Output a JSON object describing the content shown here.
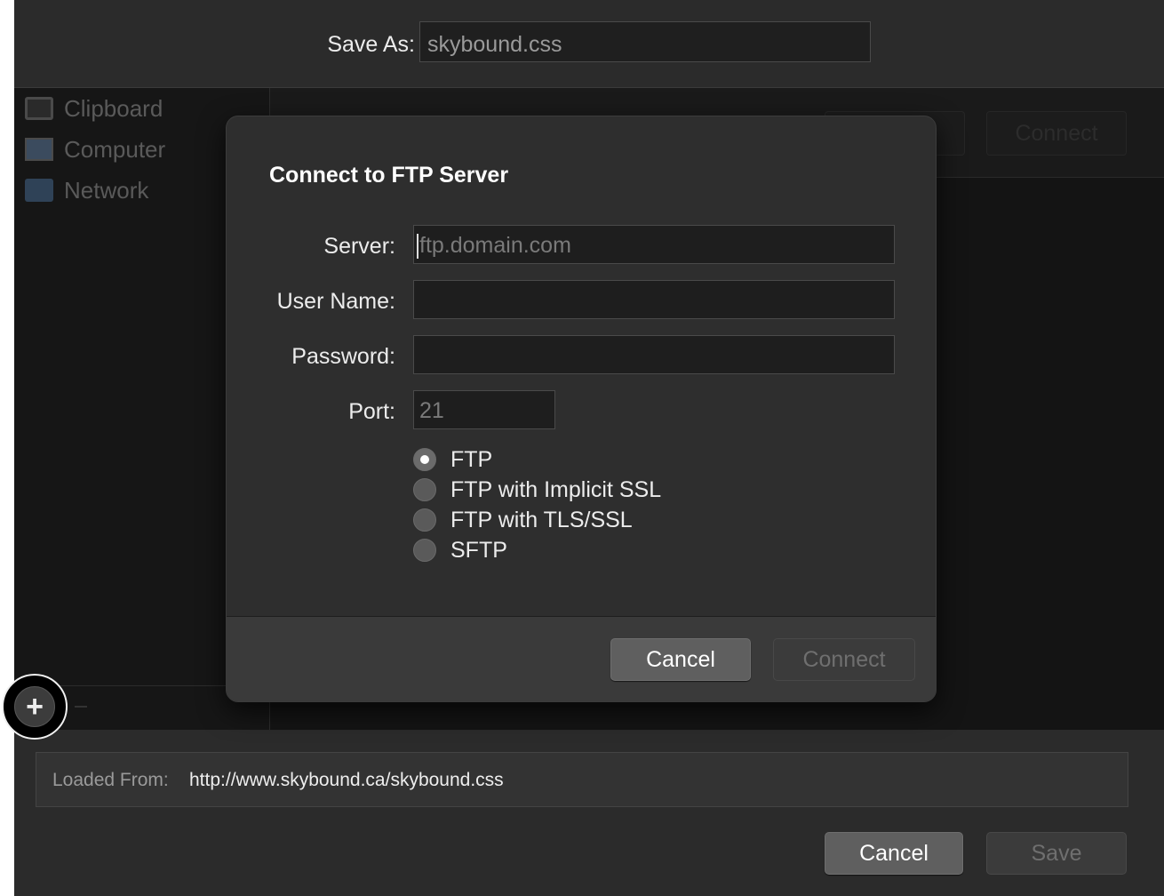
{
  "save_as": {
    "label": "Save As:",
    "value": "skybound.css"
  },
  "sidebar": {
    "items": [
      {
        "label": "Clipboard",
        "icon": "clipboard-icon"
      },
      {
        "label": "Computer",
        "icon": "computer-icon"
      },
      {
        "label": "Network",
        "icon": "network-icon"
      }
    ],
    "add_button": "+"
  },
  "toolbar": {
    "connect_ghost": "Connect"
  },
  "dialog": {
    "title": "Connect to FTP Server",
    "fields": {
      "server_label": "Server:",
      "server_placeholder": "ftp.domain.com",
      "user_label": "User Name:",
      "password_label": "Password:",
      "port_label": "Port:",
      "port_placeholder": "21"
    },
    "protocols": [
      {
        "label": "FTP",
        "selected": true
      },
      {
        "label": "FTP with Implicit SSL",
        "selected": false
      },
      {
        "label": "FTP with TLS/SSL",
        "selected": false
      },
      {
        "label": "SFTP",
        "selected": false
      }
    ],
    "cancel": "Cancel",
    "connect": "Connect"
  },
  "loaded_from": {
    "label": "Loaded From:",
    "url": "http://www.skybound.ca/skybound.css"
  },
  "footer": {
    "cancel": "Cancel",
    "save": "Save"
  }
}
